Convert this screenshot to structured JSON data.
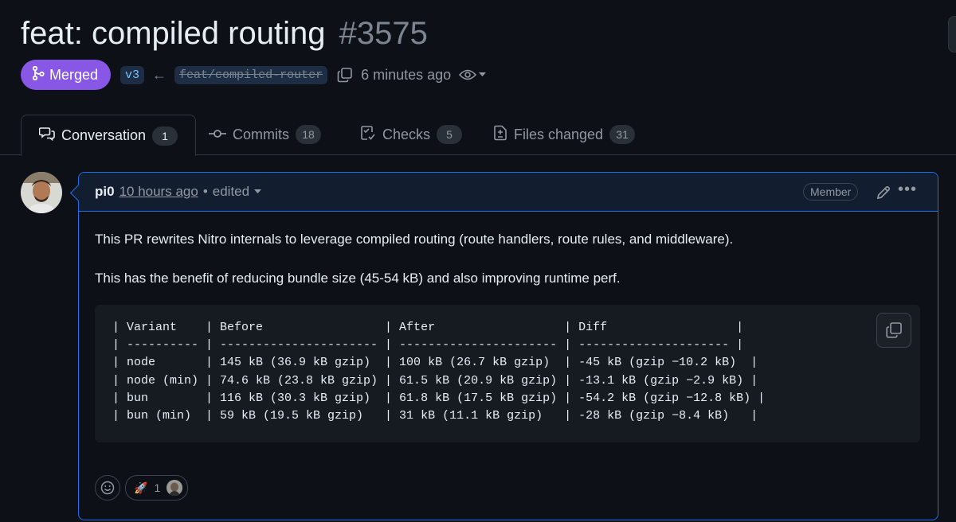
{
  "pr": {
    "title": "feat: compiled routing",
    "number": "#3575",
    "status": "Merged",
    "base_branch": "v3",
    "head_branch": "feat/compiled-router",
    "time": "6 minutes ago"
  },
  "tabs": [
    {
      "label": "Conversation",
      "count": "1",
      "icon": "conversation-icon"
    },
    {
      "label": "Commits",
      "count": "18",
      "icon": "commit-icon"
    },
    {
      "label": "Checks",
      "count": "5",
      "icon": "checklist-icon"
    },
    {
      "label": "Files changed",
      "count": "31",
      "icon": "file-diff-icon"
    }
  ],
  "comment": {
    "author": "pi0",
    "time": "10 hours ago",
    "separator": "•",
    "edited": "edited",
    "role": "Member",
    "paragraphs": [
      "This PR rewrites Nitro internals to leverage compiled routing (route handlers, route rules, and middleware).",
      "This has the benefit of reducing bundle size (45-54 kB) and also improving runtime perf."
    ],
    "code": "| Variant    | Before                 | After                  | Diff                  |\n| ---------- | ---------------------- | ---------------------- | --------------------- |\n| node       | 145 kB (36.9 kB gzip)  | 100 kB (26.7 kB gzip)  | -45 kB (gzip −10.2 kB)  |\n| node (min) | 74.6 kB (23.8 kB gzip) | 61.5 kB (20.9 kB gzip) | -13.1 kB (gzip −2.9 kB) |\n| bun        | 116 kB (30.3 kB gzip)  | 61.8 kB (17.5 kB gzip) | -54.2 kB (gzip −12.8 kB) |\n| bun (min)  | 59 kB (19.5 kB gzip)   | 31 kB (11.1 kB gzip)   | -28 kB (gzip −8.4 kB)   |",
    "reactions": [
      {
        "emoji": "🚀",
        "count": "1"
      }
    ]
  },
  "colors": {
    "background": "#0d1117",
    "merged": "#8957e5",
    "accent_border": "#1f6feb",
    "branch_text": "#79c0ff"
  }
}
